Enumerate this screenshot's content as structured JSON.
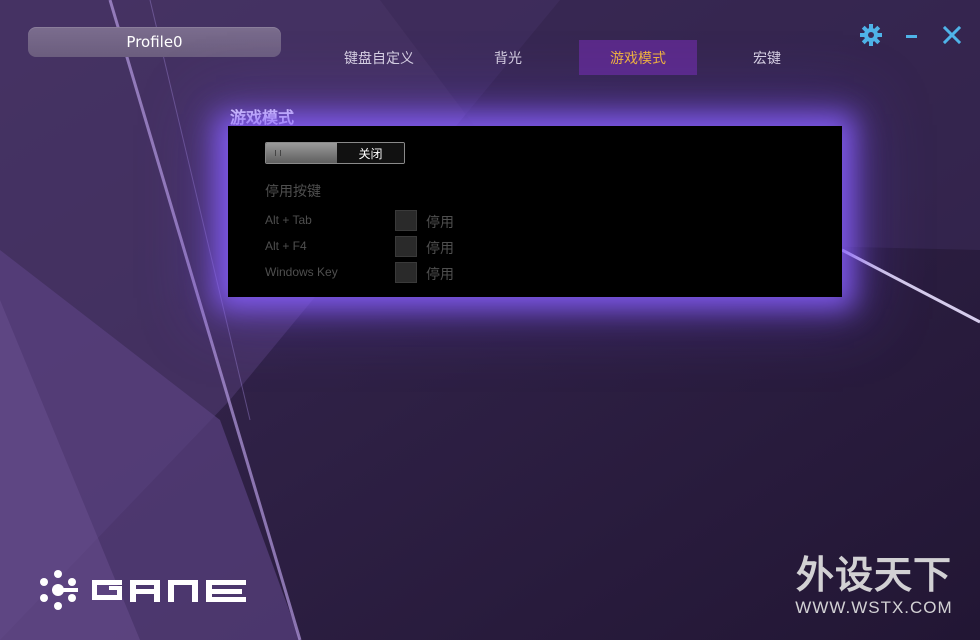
{
  "app": {
    "profile_name": "Profile0",
    "accent_color": "#f0b33d",
    "active_tab_bg": "#5a2a88",
    "icon_color": "#4fb3e8"
  },
  "tabs": [
    {
      "label": "键盘自定义",
      "active": false
    },
    {
      "label": "背光",
      "active": false
    },
    {
      "label": "游戏模式",
      "active": true
    },
    {
      "label": "宏键",
      "active": false
    }
  ],
  "window_controls": {
    "settings_icon": "gear-icon",
    "minimize_icon": "minimize-icon",
    "close_icon": "close-icon"
  },
  "game_mode": {
    "title": "游戏模式",
    "toggle_state": "关闭",
    "section_label": "停用按键",
    "keys": [
      {
        "name": "Alt + Tab",
        "option": "停用",
        "checked": false
      },
      {
        "name": "Alt + F4",
        "option": "停用",
        "checked": false
      },
      {
        "name": "Windows Key",
        "option": "停用",
        "checked": false
      }
    ]
  },
  "watermark": {
    "text_cn": "外设天下",
    "url": "WWW.WSTX.COM"
  }
}
